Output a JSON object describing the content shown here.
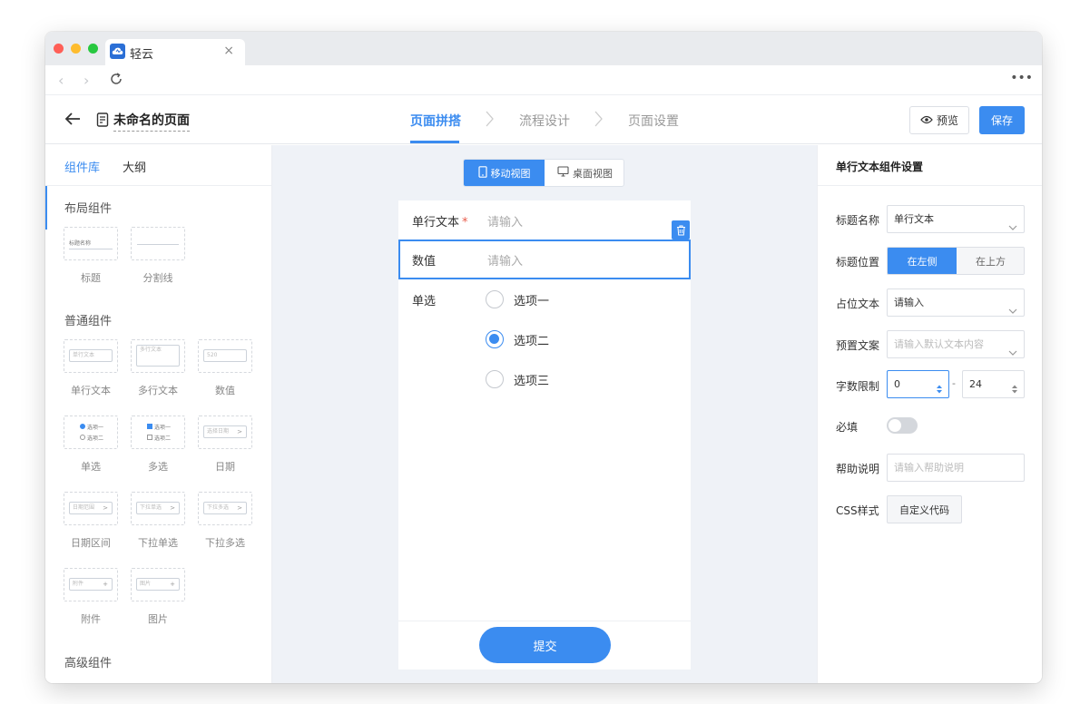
{
  "browser": {
    "tab_title": "轻云",
    "tab_close": "×",
    "more": "•••"
  },
  "header": {
    "page_name": "未命名的页面",
    "steps": [
      "页面拼搭",
      "流程设计",
      "页面设置"
    ],
    "active_step": 0,
    "preview_label": "预览",
    "save_label": "保存"
  },
  "left_panel": {
    "tabs": [
      "组件库",
      "大纲"
    ],
    "sections": {
      "layout": "布局组件",
      "common": "普通组件",
      "advanced": "高级组件"
    },
    "layout_components": [
      {
        "label": "标题",
        "mini": "标题名称"
      },
      {
        "label": "分割线",
        "mini": ""
      }
    ],
    "common_components": [
      {
        "label": "单行文本",
        "mini": "单行文本"
      },
      {
        "label": "多行文本",
        "mini": "多行文本"
      },
      {
        "label": "数值",
        "mini": "520"
      },
      {
        "label": "单选",
        "mini_options": [
          "选项一",
          "选项二"
        ]
      },
      {
        "label": "多选",
        "mini_options": [
          "选项一",
          "选项二"
        ]
      },
      {
        "label": "日期",
        "mini": "选择日期"
      },
      {
        "label": "日期区间",
        "mini": "日期范围"
      },
      {
        "label": "下拉单选",
        "mini": "下拉单选"
      },
      {
        "label": "下拉多选",
        "mini": "下拉多选"
      },
      {
        "label": "附件",
        "mini": "附件"
      },
      {
        "label": "图片",
        "mini": "图片"
      }
    ]
  },
  "canvas": {
    "view_mobile": "移动视图",
    "view_desktop": "桌面视图",
    "form": {
      "text_label": "单行文本",
      "required_mark": "*",
      "text_placeholder": "请输入",
      "number_label": "数值",
      "number_placeholder": "请输入",
      "radio_label": "单选",
      "radio_options": [
        "选项一",
        "选项二",
        "选项三"
      ],
      "radio_selected": 1,
      "submit": "提交"
    }
  },
  "right_panel": {
    "title": "单行文本组件设置",
    "title_name_label": "标题名称",
    "title_name_value": "单行文本",
    "title_pos_label": "标题位置",
    "title_pos_left": "在左侧",
    "title_pos_top": "在上方",
    "placeholder_label": "占位文本",
    "placeholder_value": "请输入",
    "preset_label": "预置文案",
    "preset_placeholder": "请输入默认文本内容",
    "limit_label": "字数限制",
    "limit_min": "0",
    "limit_sep": "-",
    "limit_max": "24",
    "required_label": "必填",
    "required_on": false,
    "help_label": "帮助说明",
    "help_placeholder": "请输入帮助说明",
    "css_label": "CSS样式",
    "css_button": "自定义代码"
  },
  "colors": {
    "accent": "#3b8cf0",
    "required": "#e85b4a"
  }
}
